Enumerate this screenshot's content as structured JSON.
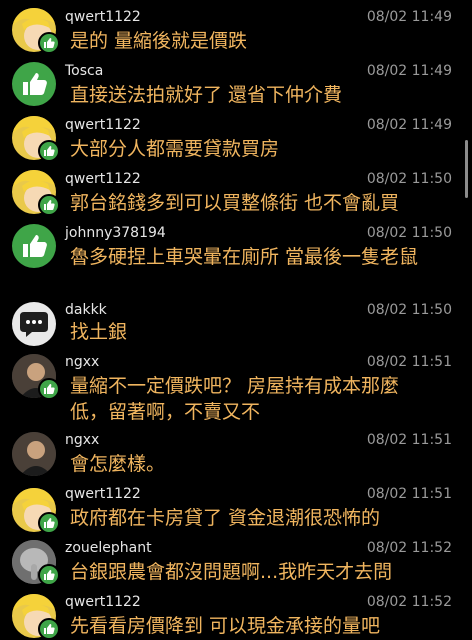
{
  "comments": [
    {
      "user": "qwert1122",
      "time": "08/02 11:49",
      "text": "是的 量縮後就是價跌",
      "avatar": "yellow"
    },
    {
      "user": "Tosca",
      "time": "08/02 11:49",
      "text": "直接送法拍就好了 還省下仲介費",
      "avatar": "green"
    },
    {
      "user": "qwert1122",
      "time": "08/02 11:49",
      "text": "大部分人都需要貸款買房",
      "avatar": "yellow"
    },
    {
      "user": "qwert1122",
      "time": "08/02 11:50",
      "text": "郭台銘錢多到可以買整條街 也不會亂買",
      "avatar": "yellow"
    },
    {
      "user": "johnny378194",
      "time": "08/02 11:50",
      "text": "魯多硬捏上車哭暈在廁所 當最後一隻老鼠",
      "avatar": "green"
    },
    {
      "user": "dakkk",
      "time": "08/02 11:50",
      "text": "找土銀",
      "avatar": "gray"
    },
    {
      "user": "ngxx",
      "time": "08/02 11:51",
      "text": "量縮不一定價跌吧？ 房屋持有成本那麼低，留著啊，不賣又不",
      "avatar": "photo"
    },
    {
      "user": "ngxx",
      "time": "08/02 11:51",
      "text": "會怎麼樣。",
      "avatar": "photo"
    },
    {
      "user": "qwert1122",
      "time": "08/02 11:51",
      "text": "政府都在卡房貸了 資金退潮很恐怖的",
      "avatar": "yellow"
    },
    {
      "user": "zouelephant",
      "time": "08/02 11:52",
      "text": "台銀跟農會都沒問題啊...我昨天才去問",
      "avatar": "elephant"
    },
    {
      "user": "qwert1122",
      "time": "08/02 11:52",
      "text": "先看看房價降到 可以現金承接的量吧",
      "avatar": "yellow"
    }
  ]
}
